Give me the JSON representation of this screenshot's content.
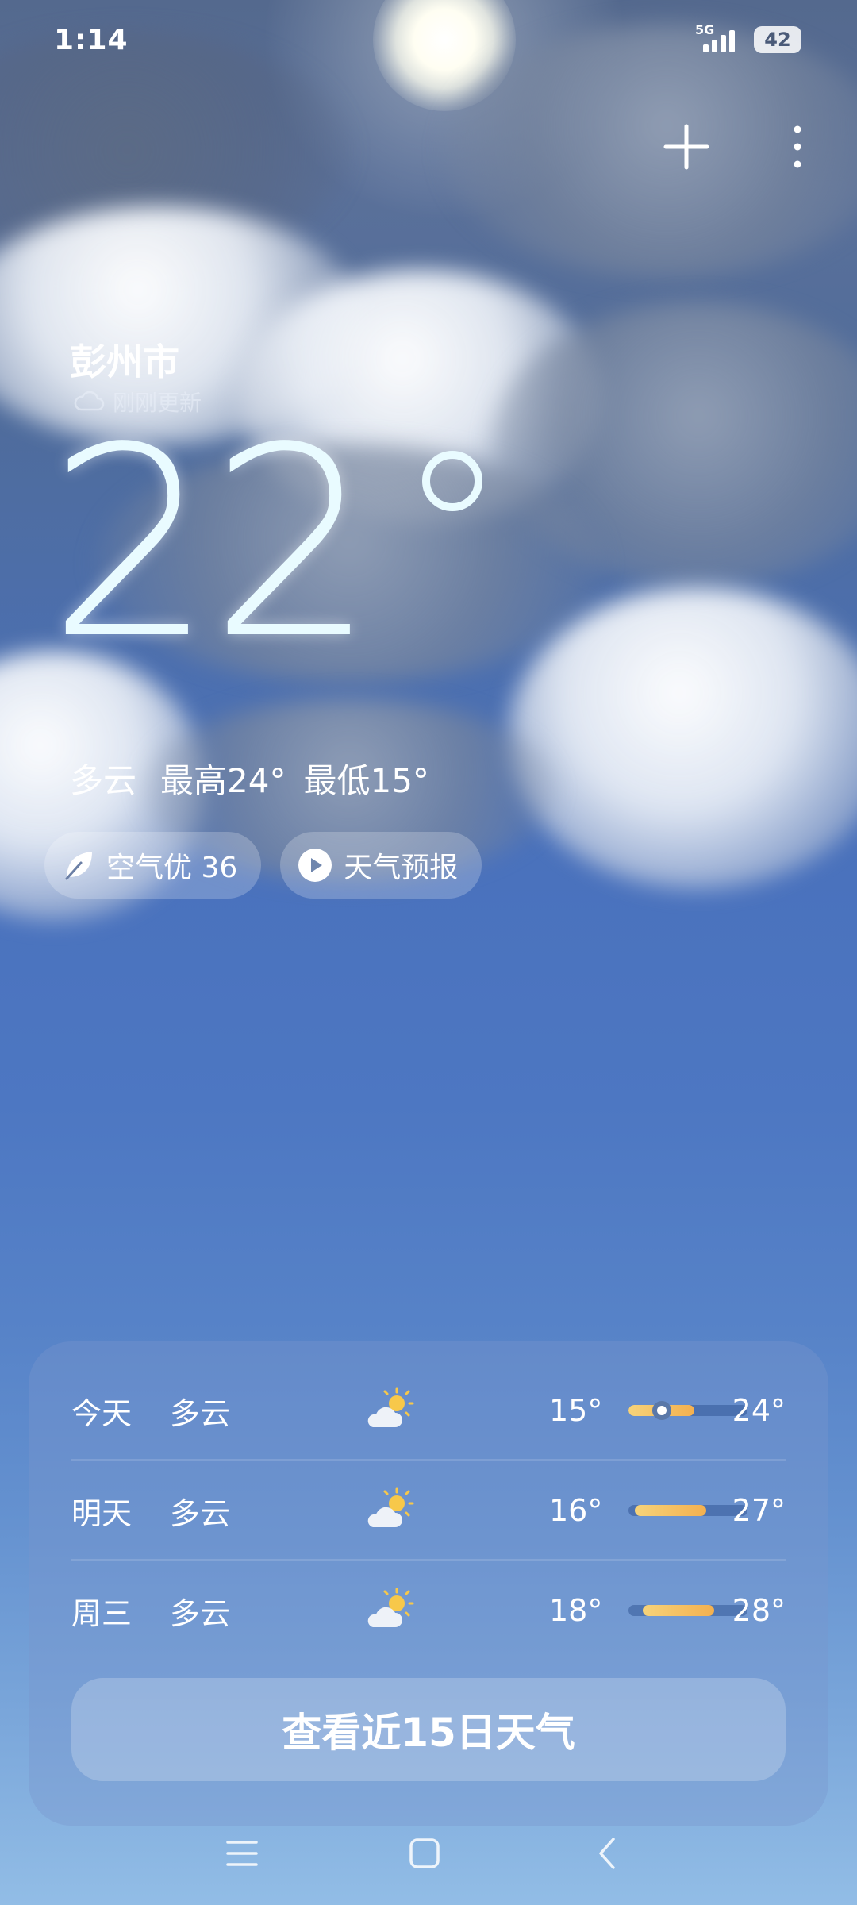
{
  "status_bar": {
    "time": "1:14",
    "network": "5G",
    "battery": "42"
  },
  "header": {
    "add_icon": "plus-icon",
    "menu_icon": "more-vertical-icon"
  },
  "location": {
    "city": "彭州市",
    "update_status": "刚刚更新"
  },
  "current": {
    "temperature": "22",
    "condition": "多云",
    "high": "最高24°",
    "low": "最低15°"
  },
  "chips": {
    "air_quality": "空气优 36",
    "forecast_video": "天气预报"
  },
  "forecast": [
    {
      "day": "今天",
      "condition": "多云",
      "icon": "partly-cloudy-icon",
      "low": "15°",
      "high": "24°",
      "range_start": 0.0,
      "range_end": 0.55,
      "current_pos": 0.28
    },
    {
      "day": "明天",
      "condition": "多云",
      "icon": "partly-cloudy-icon",
      "low": "16°",
      "high": "27°",
      "range_start": 0.05,
      "range_end": 0.65
    },
    {
      "day": "周三",
      "condition": "多云",
      "icon": "partly-cloudy-icon",
      "low": "18°",
      "high": "28°",
      "range_start": 0.12,
      "range_end": 0.72
    }
  ],
  "forecast_button": "查看近15日天气",
  "colors": {
    "temp_bar_start": "#f6d37a",
    "temp_bar_end": "#f4b04f",
    "big_temp": "#e9fbff"
  }
}
